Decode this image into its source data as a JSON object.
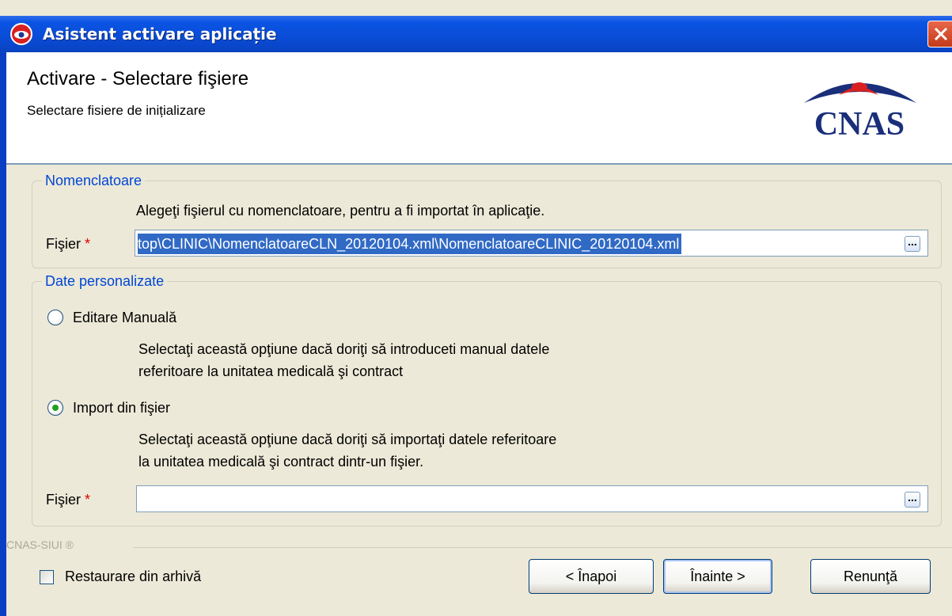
{
  "window": {
    "title": "Asistent activare aplicație"
  },
  "header": {
    "title": "Activare - Selectare fişiere",
    "subtitle": "Selectare fisiere de inițializare",
    "logo_text": "CNAS"
  },
  "nomenclatoare": {
    "legend": "Nomenclatoare",
    "description": "Alegeţi fişierul cu nomenclatoare, pentru a fi importat în aplicaţie.",
    "file_label": "Fişier",
    "required_mark": "*",
    "file_value": "top\\CLINIC\\NomenclatoareCLN_20120104.xml\\NomenclatoareCLINIC_20120104.xml",
    "browse_label": "..."
  },
  "date_personalizate": {
    "legend": "Date personalizate",
    "options": [
      {
        "label": "Editare Manuală",
        "description_line1": "Selectaţi această opţiune dacă doriţi să introduceti manual datele",
        "description_line2": "referitoare la unitatea medicală şi contract",
        "selected": false
      },
      {
        "label": "Import din fişier",
        "description_line1": "Selectaţi această opţiune dacă doriţi să importaţi datele referitoare",
        "description_line2": "la unitatea medicală şi contract dintr-un fişier.",
        "selected": true
      }
    ],
    "file_label": "Fişier",
    "required_mark": "*",
    "file_value": "",
    "browse_label": "..."
  },
  "footer": {
    "brand": "CNAS-SIUI ®",
    "restore_label": "Restaurare din arhivă",
    "restore_checked": false,
    "back_label": "< Înapoi",
    "next_label": "Înainte >",
    "cancel_label": "Renunţă"
  },
  "colors": {
    "titlebar": "#0A54E3",
    "legend_blue": "#0046D5",
    "selection": "#316AC5",
    "required": "#E00000",
    "window_bg": "#ECE9D8"
  }
}
